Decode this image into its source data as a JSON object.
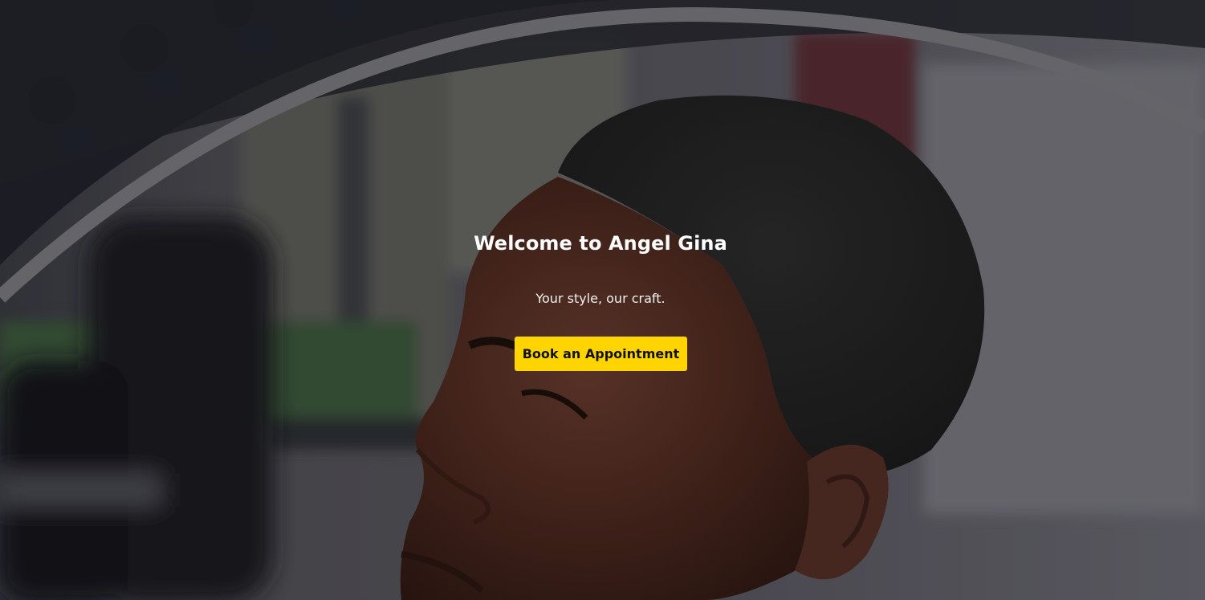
{
  "hero": {
    "title": "Welcome to Angel Gina",
    "subtitle": "Your style, our craft.",
    "cta_label": "Book an Appointment"
  },
  "colors": {
    "accent": "#ffd400",
    "cta_text": "#111111",
    "title_text": "#ffffff"
  }
}
